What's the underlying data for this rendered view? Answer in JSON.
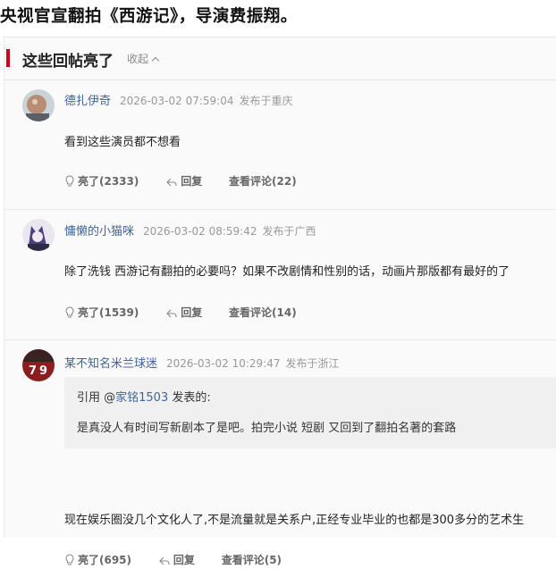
{
  "headline": "央视官宣翻拍《西游记》，导演费振翔。",
  "section": {
    "title": "这些回帖亮了",
    "collapse_label": "收起"
  },
  "comments": [
    {
      "user": "德扎伊奇",
      "time": "2026-03-02 07:59:04",
      "location": "发布于重庆",
      "text": "看到这些演员都不想看",
      "likes": "亮了(2333)",
      "reply": "回复",
      "view_replies": "查看评论(22)"
    },
    {
      "user": "慵懒的小猫咪",
      "time": "2026-03-02 08:59:42",
      "location": "发布于广西",
      "text": "除了洗钱 西游记有翻拍的必要吗？如果不改剧情和性别的话，动画片那版都有最好的了",
      "likes": "亮了(1539)",
      "reply": "回复",
      "view_replies": "查看评论(14)"
    },
    {
      "user": "某不知名米兰球迷",
      "time": "2026-03-02 10:29:47",
      "location": "发布于浙江",
      "quote_prefix": "引用 @",
      "quote_user": "家铭1503",
      "quote_suffix": " 发表的:",
      "quote_text": "是真没人有时间写新剧本了是吧。拍完小说 短剧 又回到了翻拍名著的套路",
      "text": "现在娱乐圈没几个文化人了,不是流量就是关系户,正经专业毕业的也都是300多分的艺术生",
      "likes": "亮了(695)",
      "reply": "回复",
      "view_replies": "查看评论(5)"
    }
  ],
  "icons": {
    "like": "lightbulb-icon",
    "reply": "reply-arrow-icon"
  },
  "colors": {
    "accent": "#d0021b",
    "username": "#406599"
  }
}
